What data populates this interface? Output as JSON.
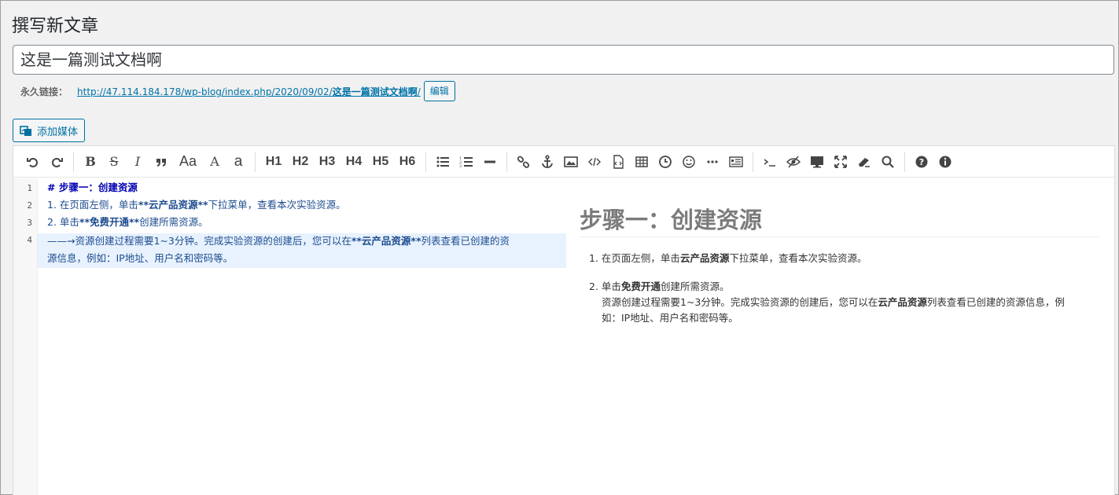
{
  "page": {
    "title": "撰写新文章"
  },
  "post": {
    "title": "这是一篇测试文档啊"
  },
  "permalink": {
    "label": "永久链接：",
    "url_prefix": "http://47.114.184.178/wp-blog/index.php/2020/09/02/",
    "slug": "这是一篇测试文档啊",
    "url_suffix": "/",
    "edit_label": "编辑"
  },
  "media": {
    "add_label": "添加媒体"
  },
  "toolbar": {
    "headings": [
      "H1",
      "H2",
      "H3",
      "H4",
      "H5",
      "H6"
    ],
    "text_a_label": "Aa",
    "text_b_label": "A",
    "text_c_label": "a",
    "italic_label": "I",
    "bold_label": "B",
    "strike_label": "S"
  },
  "code": {
    "line_numbers": [
      "1",
      "2",
      "3",
      "4"
    ],
    "lines": [
      {
        "a": "# 步骤一：创建资源"
      },
      {
        "a": "1. 在页面左侧，单击",
        "b": "**云产品资源**",
        "c": "下拉菜单，查看本次实验资源。"
      },
      {
        "a": "2. 单击",
        "b": "**免费开通**",
        "c": "创建所需资源。"
      },
      {
        "a": "——→资源创建过程需要1~3分钟。完成实验资源的创建后，您可以在",
        "b": "**云产品资源**",
        "c": "列表查看已创建的资",
        "d": "源信息，例如：IP地址、用户名和密码等。"
      }
    ]
  },
  "preview": {
    "heading": "步骤一：创建资源",
    "item1": {
      "a": "在页面左侧，单击",
      "b": "云产品资源",
      "c": "下拉菜单，查看本次实验资源。"
    },
    "item2": {
      "a": "单击",
      "b": "免费开通",
      "c": "创建所需资源。"
    },
    "item2_cont": {
      "a": "资源创建过程需要1~3分钟。完成实验资源的创建后，您可以在",
      "b": "云产品资源",
      "c": "列表查看已创建的资源信息，例",
      "d": "如：IP地址、用户名和密码等。"
    },
    "num1": "1.",
    "num2": "2."
  }
}
